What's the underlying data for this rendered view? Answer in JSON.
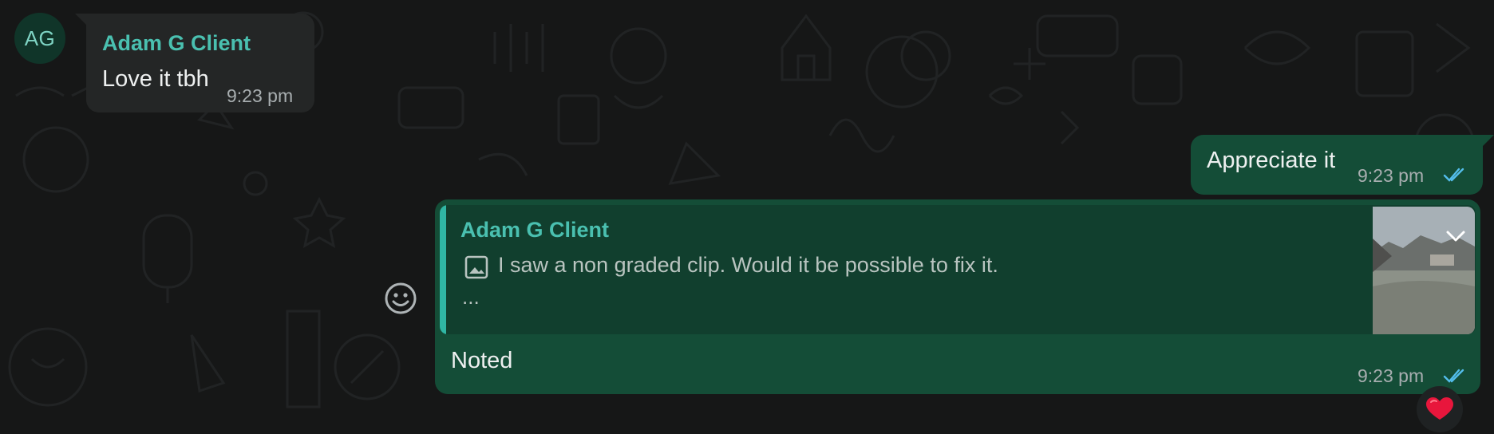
{
  "theme": {
    "background": "#161717",
    "incoming_bubble": "#242626",
    "outgoing_bubble": "#144d37",
    "quote_background": "#113f2e",
    "accent": "#4ac0b0",
    "read_ticks": "#53bdeb",
    "reaction_color": "#e8163c"
  },
  "incoming_message": {
    "avatar_initials": "AG",
    "sender": "Adam G Client",
    "text": "Love it tbh",
    "time": "9:23 pm"
  },
  "outgoing_message_1": {
    "text": "Appreciate it",
    "time": "9:23 pm",
    "status_icon": "double-check-read-icon"
  },
  "outgoing_reply": {
    "quoted": {
      "sender": "Adam G Client",
      "media_icon": "image-icon",
      "text": "I saw a non graded clip. Would it be possible to fix it.",
      "more": "...",
      "thumbnail": "landscape-image-thumbnail"
    },
    "menu_icon": "chevron-down-icon",
    "text": "Noted",
    "time": "9:23 pm",
    "status_icon": "double-check-read-icon",
    "reaction": "❤️"
  },
  "actions": {
    "emoji_icon": "emoji-smiley-icon"
  }
}
